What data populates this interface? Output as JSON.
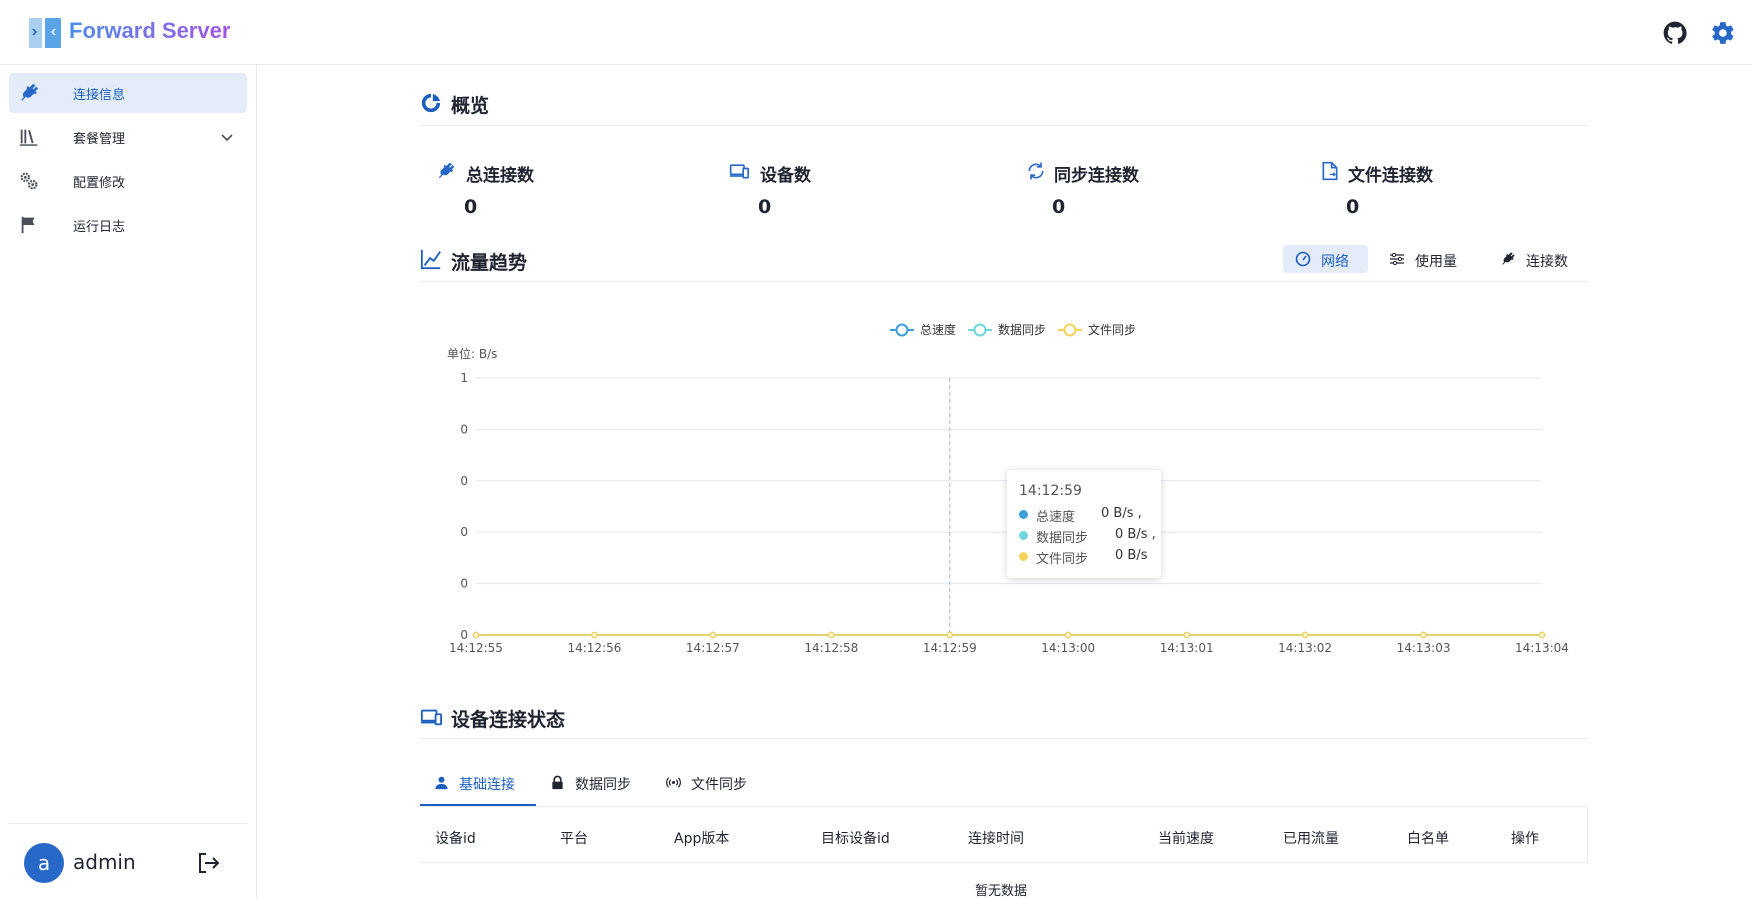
{
  "app": {
    "title": "Forward Server"
  },
  "sidebar": {
    "items": [
      {
        "label": "连接信息",
        "icon": "plug-icon"
      },
      {
        "label": "套餐管理",
        "icon": "library-icon"
      },
      {
        "label": "配置修改",
        "icon": "gears-icon"
      },
      {
        "label": "运行日志",
        "icon": "flag-icon"
      }
    ],
    "user": {
      "avatar_letter": "a",
      "name": "admin"
    }
  },
  "overview": {
    "title": "概览",
    "stats": [
      {
        "label": "总连接数",
        "value": "0",
        "icon": "plug-icon"
      },
      {
        "label": "设备数",
        "value": "0",
        "icon": "devices-icon"
      },
      {
        "label": "同步连接数",
        "value": "0",
        "icon": "sync-icon"
      },
      {
        "label": "文件连接数",
        "value": "0",
        "icon": "file-sync-icon"
      }
    ]
  },
  "traffic": {
    "title": "流量趋势",
    "segments": [
      {
        "label": "网络",
        "icon": "speedometer-icon"
      },
      {
        "label": "使用量",
        "icon": "sliders-icon"
      },
      {
        "label": "连接数",
        "icon": "plug-icon"
      }
    ]
  },
  "chart_data": {
    "type": "line",
    "x": [
      "14:12:55",
      "14:12:56",
      "14:12:57",
      "14:12:58",
      "14:12:59",
      "14:13:00",
      "14:13:01",
      "14:13:02",
      "14:13:03",
      "14:13:04"
    ],
    "y_ticks": [
      "0",
      "0",
      "0",
      "0",
      "0",
      "1"
    ],
    "ylabel": "单位:  B/s",
    "ylim": [
      0,
      1
    ],
    "legend_position": "top-center",
    "series": [
      {
        "name": "总速度",
        "values": [
          0,
          0,
          0,
          0,
          0,
          0,
          0,
          0,
          0,
          0
        ],
        "color": "#3c9ed8"
      },
      {
        "name": "数据同步",
        "values": [
          0,
          0,
          0,
          0,
          0,
          0,
          0,
          0,
          0,
          0
        ],
        "color": "#6fd6dc"
      },
      {
        "name": "文件同步",
        "values": [
          0,
          0,
          0,
          0,
          0,
          0,
          0,
          0,
          0,
          0
        ],
        "color": "#f5d35a"
      }
    ],
    "tooltip": {
      "time": "14:12:59",
      "rows": [
        {
          "name": "总速度",
          "value": "0 B/s ,"
        },
        {
          "name": "数据同步",
          "value": "0 B/s ,"
        },
        {
          "name": "文件同步",
          "value": "0 B/s"
        }
      ]
    },
    "grid": true
  },
  "devices": {
    "title": "设备连接状态",
    "tabs": [
      {
        "label": "基础连接",
        "icon": "user-icon"
      },
      {
        "label": "数据同步",
        "icon": "lock-icon"
      },
      {
        "label": "文件同步",
        "icon": "broadcast-icon"
      }
    ],
    "columns": [
      "设备id",
      "平台",
      "App版本",
      "目标设备id",
      "连接时间",
      "当前速度",
      "已用流量",
      "白名单",
      "操作"
    ],
    "empty_text": "暂无数据"
  },
  "colors": {
    "accent": "#1c5fbd",
    "active_bg": "#e3ecf8",
    "avatar": "#2869c7"
  }
}
